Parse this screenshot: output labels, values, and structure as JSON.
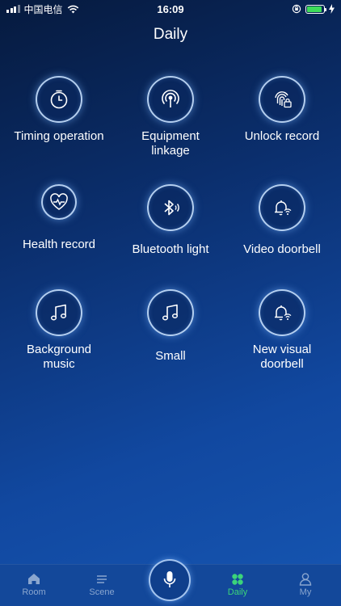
{
  "status_bar": {
    "carrier": "中国电信",
    "time": "16:09",
    "battery_level": 0.9,
    "battery_color": "#3ddc5a"
  },
  "header": {
    "title": "Daily"
  },
  "features": [
    {
      "label_lines": [
        "Timing operation"
      ],
      "icon": "timer-icon"
    },
    {
      "label_lines": [
        "Equipment",
        "linkage"
      ],
      "icon": "broadcast-icon"
    },
    {
      "label_lines": [
        "Unlock record"
      ],
      "icon": "fingerprint-lock-icon"
    },
    {
      "label_lines": [
        "Health record"
      ],
      "icon": "heart-rate-icon"
    },
    {
      "label_lines": [
        "Bluetooth light"
      ],
      "icon": "bluetooth-icon"
    },
    {
      "label_lines": [
        "Video doorbell"
      ],
      "icon": "bell-wifi-icon"
    },
    {
      "label_lines": [
        "Background",
        "music"
      ],
      "icon": "music-note-icon"
    },
    {
      "label_lines": [
        "Small"
      ],
      "icon": "music-note-icon"
    },
    {
      "label_lines": [
        "New visual",
        "doorbell"
      ],
      "icon": "bell-wifi-icon"
    }
  ],
  "tab_bar": {
    "tabs": [
      {
        "label": "Room",
        "icon": "home-icon",
        "active": false
      },
      {
        "label": "Scene",
        "icon": "list-icon",
        "active": false
      },
      {
        "label": "Daily",
        "icon": "grid-icon",
        "active": true
      },
      {
        "label": "My",
        "icon": "user-icon",
        "active": false
      }
    ],
    "voice_icon": "microphone-icon",
    "active_color": "#3bd47a",
    "inactive_color": "#8aa6cf"
  }
}
